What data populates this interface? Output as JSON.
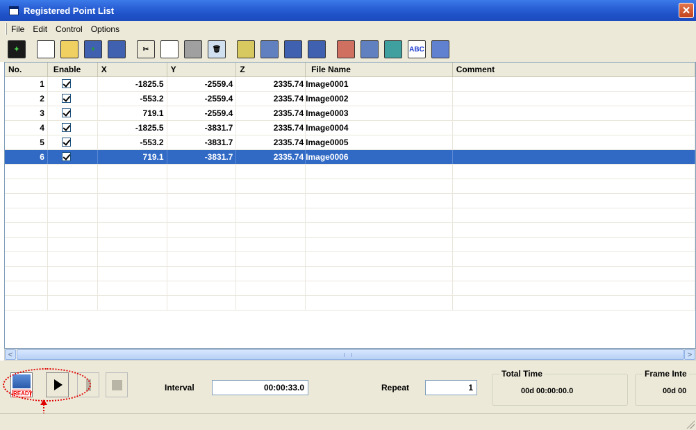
{
  "window": {
    "title": "Registered Point List"
  },
  "menu": [
    "File",
    "Edit",
    "Control",
    "Options"
  ],
  "toolbar": [
    {
      "icon": "chart-icon",
      "bg": "#1a1a1a",
      "glyph": "✦",
      "color": "#4cd24c"
    },
    {
      "icon": "new-file-icon",
      "bg": "#ffffff",
      "glyph": "",
      "color": "#000"
    },
    {
      "icon": "open-folder-icon",
      "bg": "#f0d060",
      "glyph": "",
      "color": "#000"
    },
    {
      "icon": "save-as-icon",
      "bg": "#4060b0",
      "glyph": "+",
      "color": "#2a2"
    },
    {
      "icon": "save-icon",
      "bg": "#4060b0",
      "glyph": "",
      "color": "#000"
    },
    {
      "icon": "cut-icon",
      "bg": "#ece9d8",
      "glyph": "✂",
      "color": "#000"
    },
    {
      "icon": "copy-icon",
      "bg": "#ffffff",
      "glyph": "",
      "color": "#000"
    },
    {
      "icon": "paste-icon",
      "bg": "#a0a0a0",
      "glyph": "",
      "color": "#000"
    },
    {
      "icon": "delete-icon",
      "bg": "#d0e0f0",
      "glyph": "🗑",
      "color": "#000"
    },
    {
      "icon": "register-matl-icon",
      "bg": "#d8c860",
      "glyph": "",
      "color": "#000"
    },
    {
      "icon": "register-point-icon",
      "bg": "#6080c0",
      "glyph": "",
      "color": "#000"
    },
    {
      "icon": "shift-icon",
      "bg": "#4060b0",
      "glyph": "",
      "color": "#000"
    },
    {
      "icon": "refresh-icon",
      "bg": "#4060b0",
      "glyph": "",
      "color": "#000"
    },
    {
      "icon": "export-matl-icon",
      "bg": "#d07060",
      "glyph": "",
      "color": "#000"
    },
    {
      "icon": "save-settings-icon",
      "bg": "#6080c0",
      "glyph": "",
      "color": "#000"
    },
    {
      "icon": "image-settings-icon",
      "bg": "#40a0a0",
      "glyph": "",
      "color": "#000"
    },
    {
      "icon": "abc-icon",
      "bg": "#ffffff",
      "glyph": "ABC",
      "color": "#1a3ad0"
    },
    {
      "icon": "properties-icon",
      "bg": "#6080d0",
      "glyph": "",
      "color": "#000"
    }
  ],
  "table": {
    "columns": [
      "No.",
      "Enable",
      "X",
      "Y",
      "Z",
      "File Name",
      "Comment"
    ],
    "rows": [
      {
        "no": "1",
        "enable": true,
        "x": "-1825.5",
        "y": "-2559.4",
        "z": "2335.74",
        "file": "Image0001",
        "comment": ""
      },
      {
        "no": "2",
        "enable": true,
        "x": "-553.2",
        "y": "-2559.4",
        "z": "2335.74",
        "file": "Image0002",
        "comment": ""
      },
      {
        "no": "3",
        "enable": true,
        "x": "719.1",
        "y": "-2559.4",
        "z": "2335.74",
        "file": "Image0003",
        "comment": ""
      },
      {
        "no": "4",
        "enable": true,
        "x": "-1825.5",
        "y": "-3831.7",
        "z": "2335.74",
        "file": "Image0004",
        "comment": ""
      },
      {
        "no": "5",
        "enable": true,
        "x": "-553.2",
        "y": "-3831.7",
        "z": "2335.74",
        "file": "Image0005",
        "comment": ""
      },
      {
        "no": "6",
        "enable": true,
        "x": "719.1",
        "y": "-3831.7",
        "z": "2335.74",
        "file": "Image0006",
        "comment": "",
        "selected": true
      }
    ]
  },
  "controls": {
    "ready_label": "READY",
    "interval_label": "Interval",
    "interval_value": "00:00:33.0",
    "repeat_label": "Repeat",
    "repeat_value": "1",
    "total_time_label": "Total Time",
    "total_time_value": "00d 00:00:00.0",
    "frame_interval_label": "Frame Inte",
    "frame_interval_value": "00d 00"
  },
  "colors": {
    "selection": "#316ac5",
    "titlebar": "#2a60d6",
    "annotation": "#e00000"
  }
}
